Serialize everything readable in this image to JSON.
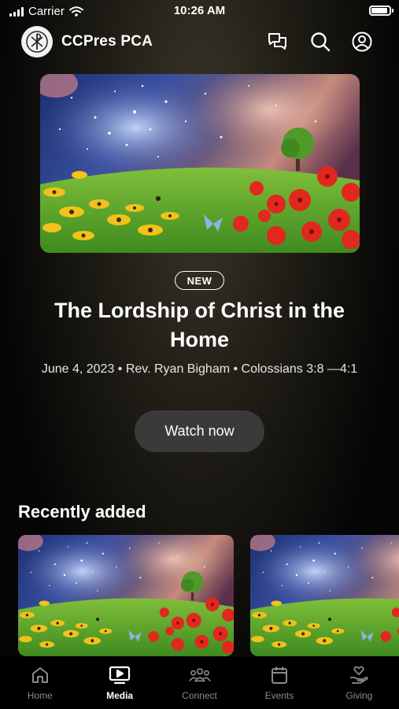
{
  "status_bar": {
    "carrier": "Carrier",
    "time": "10:26 AM"
  },
  "header": {
    "church_name": "CCPres PCA",
    "icons": [
      "chat-icon",
      "search-icon",
      "account-icon"
    ]
  },
  "hero": {
    "badge": "NEW",
    "title": "The Lordship of Christ in the Home",
    "meta": "June 4, 2023 • Rev. Ryan Bigham • Colossians 3:8 —4:1",
    "watch_label": "Watch now"
  },
  "recent": {
    "title": "Recently added"
  },
  "tabs": [
    {
      "label": "Home",
      "icon": "home-icon",
      "active": false
    },
    {
      "label": "Media",
      "icon": "media-icon",
      "active": true
    },
    {
      "label": "Connect",
      "icon": "people-icon",
      "active": false
    },
    {
      "label": "Events",
      "icon": "calendar-icon",
      "active": false
    },
    {
      "label": "Giving",
      "icon": "giving-icon",
      "active": false
    }
  ],
  "colors": {
    "background": "#000000",
    "button": "#3a3a3a",
    "inactive_tab": "#8a8a8a"
  }
}
